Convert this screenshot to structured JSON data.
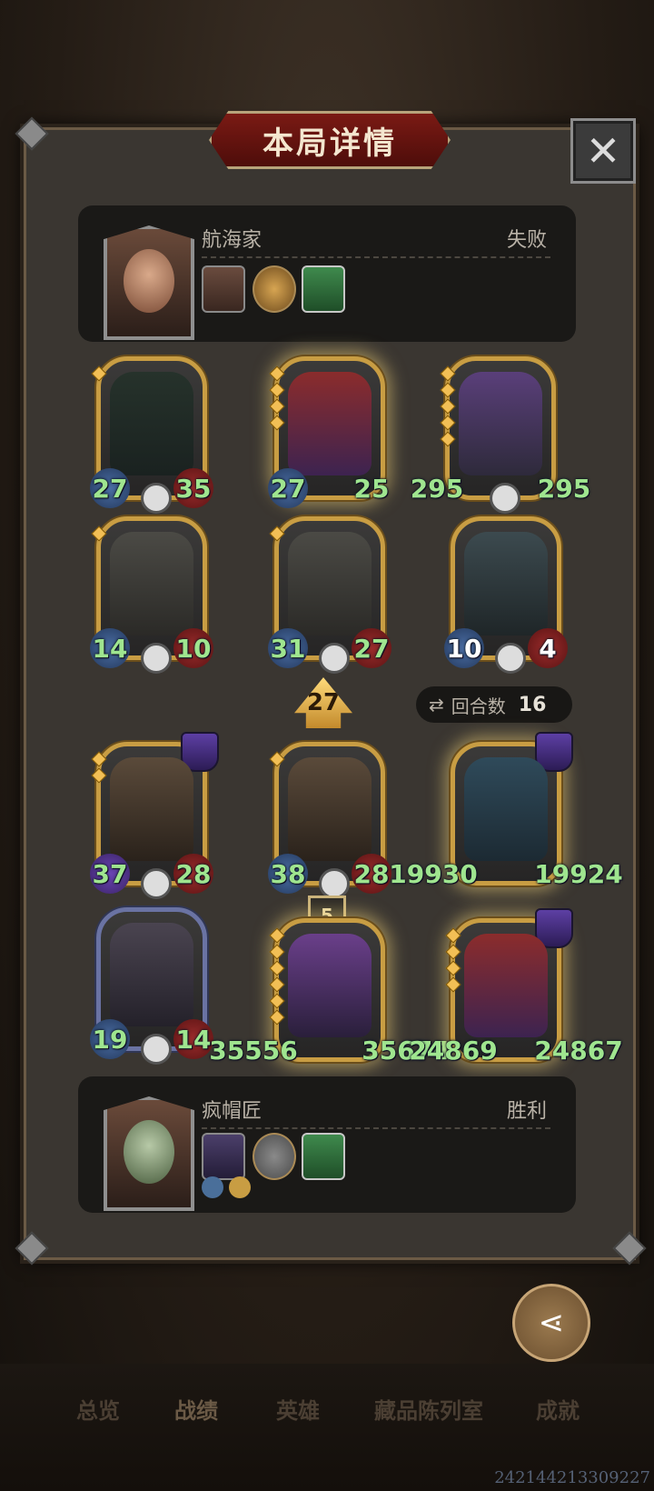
{
  "title": "本局详情",
  "close_glyph": "✕",
  "opponent": {
    "name": "航海家",
    "result": "失败"
  },
  "player": {
    "name": "疯帽匠",
    "result": "胜利"
  },
  "opponent_board": [
    {
      "atk": "27",
      "hp": "35"
    },
    {
      "atk": "27",
      "hp": "25"
    },
    {
      "atk": "295",
      "hp": "295"
    },
    {
      "atk": "14",
      "hp": "10"
    },
    {
      "atk": "31",
      "hp": "27"
    },
    {
      "atk": "10",
      "hp": "4"
    }
  ],
  "turn_badge": "27",
  "round": {
    "label": "回合数",
    "value": "16"
  },
  "player_board": [
    {
      "atk": "37",
      "hp": "28"
    },
    {
      "atk": "38",
      "hp": "28"
    },
    {
      "atk": "19930",
      "hp": "19924"
    },
    {
      "atk": "19",
      "hp": "14"
    },
    {
      "atk": "35556",
      "hp": "35674"
    },
    {
      "atk": "24869",
      "hp": "24867"
    }
  ],
  "card_level": "5",
  "share_label": "分享",
  "tabs": [
    "总览",
    "战绩",
    "英雄",
    "藏品陈列室",
    "成就"
  ],
  "footer_code": "242144213309227"
}
